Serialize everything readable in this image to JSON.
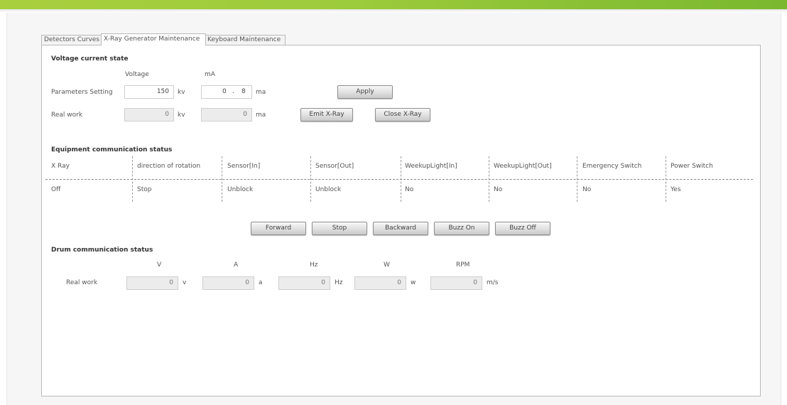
{
  "tabs": [
    {
      "label": "Detectors Curves"
    },
    {
      "label": "X-Ray Generator Maintenance"
    },
    {
      "label": "Keyboard Maintenance"
    }
  ],
  "voltage_section": {
    "title": "Voltage current state",
    "voltage_header": "Voltage",
    "ma_header": "mA",
    "parameters_label": "Parameters Setting",
    "real_work_label": "Real work",
    "voltage_set": "150",
    "voltage_unit": "kv",
    "ma_set_int": "0",
    "ma_dot": ".",
    "ma_set_dec": "8",
    "ma_unit": "ma",
    "voltage_real": "0",
    "ma_real": "0",
    "apply_label": "Apply",
    "emit_label": "Emit X-Ray",
    "close_label": "Close X-Ray"
  },
  "equipment_section": {
    "title": "Equipment communication status",
    "headers": [
      "X Ray",
      "direction of rotation",
      "Sensor[In]",
      "Sensor[Out]",
      "WeekupLight[In]",
      "WeekupLight[Out]",
      "Emergency Switch",
      "Power Switch"
    ],
    "values": [
      "Off",
      "Stop",
      "Unblock",
      "Unblock",
      "No",
      "No",
      "No",
      "Yes"
    ],
    "buttons": [
      "Forward",
      "Stop",
      "Backward",
      "Buzz On",
      "Buzz Off"
    ]
  },
  "drum_section": {
    "title": "Drum communication status",
    "real_work_label": "Real work",
    "columns": [
      {
        "header": "V",
        "value": "0",
        "unit": "v"
      },
      {
        "header": "A",
        "value": "0",
        "unit": "a"
      },
      {
        "header": "Hz",
        "value": "0",
        "unit": "Hz"
      },
      {
        "header": "W",
        "value": "0",
        "unit": "w"
      },
      {
        "header": "RPM",
        "value": "0",
        "unit": "m/s"
      }
    ]
  }
}
